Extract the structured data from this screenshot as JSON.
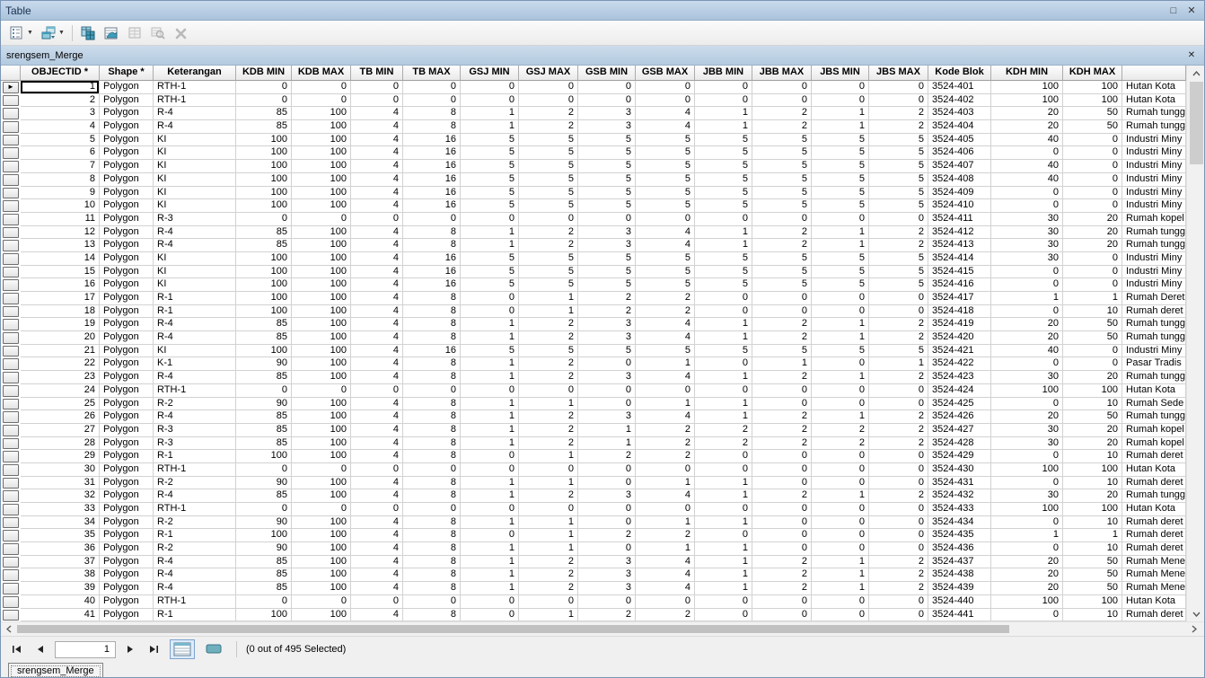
{
  "window": {
    "title": "Table",
    "maximize_icon": "□",
    "close_icon": "✕"
  },
  "toolbar": {
    "buttons": [
      {
        "name": "table-options",
        "dropdown": true,
        "enabled": true
      },
      {
        "name": "related-tables",
        "dropdown": true,
        "enabled": true
      },
      {
        "name": "select-by-attributes",
        "dropdown": false,
        "enabled": true
      },
      {
        "name": "switch-selection",
        "dropdown": false,
        "enabled": true
      },
      {
        "name": "clear-selection",
        "dropdown": false,
        "enabled": false
      },
      {
        "name": "zoom-to-selected",
        "dropdown": false,
        "enabled": false
      },
      {
        "name": "delete-selected",
        "dropdown": false,
        "enabled": false
      }
    ],
    "dropdown_caret": "▼"
  },
  "table": {
    "name": "srengsem_Merge",
    "close_icon": "✕",
    "current_record_marker": "►",
    "current_record_row": 1,
    "columns": [
      "OBJECTID *",
      "Shape *",
      "Keterangan",
      "KDB MIN",
      "KDB MAX",
      "TB MIN",
      "TB MAX",
      "GSJ MIN",
      "GSJ MAX",
      "GSB MIN",
      "GSB MAX",
      "JBB MIN",
      "JBB MAX",
      "JBS MIN",
      "JBS MAX",
      "Kode Blok",
      "KDH MIN",
      "KDH MAX",
      ""
    ],
    "rows": [
      [
        1,
        "Polygon",
        "RTH-1",
        0,
        0,
        0,
        0,
        0,
        0,
        0,
        0,
        0,
        0,
        0,
        0,
        "3524-401",
        100,
        100,
        "Hutan Kota"
      ],
      [
        2,
        "Polygon",
        "RTH-1",
        0,
        0,
        0,
        0,
        0,
        0,
        0,
        0,
        0,
        0,
        0,
        0,
        "3524-402",
        100,
        100,
        "Hutan Kota"
      ],
      [
        3,
        "Polygon",
        "R-4",
        85,
        100,
        4,
        8,
        1,
        2,
        3,
        4,
        1,
        2,
        1,
        2,
        "3524-403",
        20,
        50,
        "Rumah tungg"
      ],
      [
        4,
        "Polygon",
        "R-4",
        85,
        100,
        4,
        8,
        1,
        2,
        3,
        4,
        1,
        2,
        1,
        2,
        "3524-404",
        20,
        50,
        "Rumah tungg"
      ],
      [
        5,
        "Polygon",
        "KI",
        100,
        100,
        4,
        16,
        5,
        5,
        5,
        5,
        5,
        5,
        5,
        5,
        "3524-405",
        40,
        0,
        "Industri Miny"
      ],
      [
        6,
        "Polygon",
        "KI",
        100,
        100,
        4,
        16,
        5,
        5,
        5,
        5,
        5,
        5,
        5,
        5,
        "3524-406",
        0,
        0,
        "Industri Miny"
      ],
      [
        7,
        "Polygon",
        "KI",
        100,
        100,
        4,
        16,
        5,
        5,
        5,
        5,
        5,
        5,
        5,
        5,
        "3524-407",
        40,
        0,
        "Industri Miny"
      ],
      [
        8,
        "Polygon",
        "KI",
        100,
        100,
        4,
        16,
        5,
        5,
        5,
        5,
        5,
        5,
        5,
        5,
        "3524-408",
        40,
        0,
        "Industri Miny"
      ],
      [
        9,
        "Polygon",
        "KI",
        100,
        100,
        4,
        16,
        5,
        5,
        5,
        5,
        5,
        5,
        5,
        5,
        "3524-409",
        0,
        0,
        "Industri Miny"
      ],
      [
        10,
        "Polygon",
        "KI",
        100,
        100,
        4,
        16,
        5,
        5,
        5,
        5,
        5,
        5,
        5,
        5,
        "3524-410",
        0,
        0,
        "Industri Miny"
      ],
      [
        11,
        "Polygon",
        "R-3",
        0,
        0,
        0,
        0,
        0,
        0,
        0,
        0,
        0,
        0,
        0,
        0,
        "3524-411",
        30,
        20,
        "Rumah kopel"
      ],
      [
        12,
        "Polygon",
        "R-4",
        85,
        100,
        4,
        8,
        1,
        2,
        3,
        4,
        1,
        2,
        1,
        2,
        "3524-412",
        30,
        20,
        "Rumah tungg"
      ],
      [
        13,
        "Polygon",
        "R-4",
        85,
        100,
        4,
        8,
        1,
        2,
        3,
        4,
        1,
        2,
        1,
        2,
        "3524-413",
        30,
        20,
        "Rumah tungg"
      ],
      [
        14,
        "Polygon",
        "KI",
        100,
        100,
        4,
        16,
        5,
        5,
        5,
        5,
        5,
        5,
        5,
        5,
        "3524-414",
        30,
        0,
        "Industri Miny"
      ],
      [
        15,
        "Polygon",
        "KI",
        100,
        100,
        4,
        16,
        5,
        5,
        5,
        5,
        5,
        5,
        5,
        5,
        "3524-415",
        0,
        0,
        "Industri Miny"
      ],
      [
        16,
        "Polygon",
        "KI",
        100,
        100,
        4,
        16,
        5,
        5,
        5,
        5,
        5,
        5,
        5,
        5,
        "3524-416",
        0,
        0,
        "Industri Miny"
      ],
      [
        17,
        "Polygon",
        "R-1",
        100,
        100,
        4,
        8,
        0,
        1,
        2,
        2,
        0,
        0,
        0,
        0,
        "3524-417",
        1,
        1,
        "Rumah Deret"
      ],
      [
        18,
        "Polygon",
        "R-1",
        100,
        100,
        4,
        8,
        0,
        1,
        2,
        2,
        0,
        0,
        0,
        0,
        "3524-418",
        0,
        10,
        "Rumah deret"
      ],
      [
        19,
        "Polygon",
        "R-4",
        85,
        100,
        4,
        8,
        1,
        2,
        3,
        4,
        1,
        2,
        1,
        2,
        "3524-419",
        20,
        50,
        "Rumah tungg"
      ],
      [
        20,
        "Polygon",
        "R-4",
        85,
        100,
        4,
        8,
        1,
        2,
        3,
        4,
        1,
        2,
        1,
        2,
        "3524-420",
        20,
        50,
        "Rumah tungg"
      ],
      [
        21,
        "Polygon",
        "KI",
        100,
        100,
        4,
        16,
        5,
        5,
        5,
        5,
        5,
        5,
        5,
        5,
        "3524-421",
        40,
        0,
        "Industri Miny"
      ],
      [
        22,
        "Polygon",
        "K-1",
        90,
        100,
        4,
        8,
        1,
        2,
        0,
        1,
        0,
        1,
        0,
        1,
        "3524-422",
        0,
        0,
        "Pasar Tradis"
      ],
      [
        23,
        "Polygon",
        "R-4",
        85,
        100,
        4,
        8,
        1,
        2,
        3,
        4,
        1,
        2,
        1,
        2,
        "3524-423",
        30,
        20,
        "Rumah tungg"
      ],
      [
        24,
        "Polygon",
        "RTH-1",
        0,
        0,
        0,
        0,
        0,
        0,
        0,
        0,
        0,
        0,
        0,
        0,
        "3524-424",
        100,
        100,
        "Hutan Kota"
      ],
      [
        25,
        "Polygon",
        "R-2",
        90,
        100,
        4,
        8,
        1,
        1,
        0,
        1,
        1,
        0,
        0,
        0,
        "3524-425",
        0,
        10,
        "Rumah Sede"
      ],
      [
        26,
        "Polygon",
        "R-4",
        85,
        100,
        4,
        8,
        1,
        2,
        3,
        4,
        1,
        2,
        1,
        2,
        "3524-426",
        20,
        50,
        "Rumah tungg"
      ],
      [
        27,
        "Polygon",
        "R-3",
        85,
        100,
        4,
        8,
        1,
        2,
        1,
        2,
        2,
        2,
        2,
        2,
        "3524-427",
        30,
        20,
        "Rumah kopel"
      ],
      [
        28,
        "Polygon",
        "R-3",
        85,
        100,
        4,
        8,
        1,
        2,
        1,
        2,
        2,
        2,
        2,
        2,
        "3524-428",
        30,
        20,
        "Rumah kopel"
      ],
      [
        29,
        "Polygon",
        "R-1",
        100,
        100,
        4,
        8,
        0,
        1,
        2,
        2,
        0,
        0,
        0,
        0,
        "3524-429",
        0,
        10,
        "Rumah deret"
      ],
      [
        30,
        "Polygon",
        "RTH-1",
        0,
        0,
        0,
        0,
        0,
        0,
        0,
        0,
        0,
        0,
        0,
        0,
        "3524-430",
        100,
        100,
        "Hutan Kota"
      ],
      [
        31,
        "Polygon",
        "R-2",
        90,
        100,
        4,
        8,
        1,
        1,
        0,
        1,
        1,
        0,
        0,
        0,
        "3524-431",
        0,
        10,
        "Rumah deret"
      ],
      [
        32,
        "Polygon",
        "R-4",
        85,
        100,
        4,
        8,
        1,
        2,
        3,
        4,
        1,
        2,
        1,
        2,
        "3524-432",
        30,
        20,
        "Rumah tungg"
      ],
      [
        33,
        "Polygon",
        "RTH-1",
        0,
        0,
        0,
        0,
        0,
        0,
        0,
        0,
        0,
        0,
        0,
        0,
        "3524-433",
        100,
        100,
        "Hutan Kota"
      ],
      [
        34,
        "Polygon",
        "R-2",
        90,
        100,
        4,
        8,
        1,
        1,
        0,
        1,
        1,
        0,
        0,
        0,
        "3524-434",
        0,
        10,
        "Rumah deret"
      ],
      [
        35,
        "Polygon",
        "R-1",
        100,
        100,
        4,
        8,
        0,
        1,
        2,
        2,
        0,
        0,
        0,
        0,
        "3524-435",
        1,
        1,
        "Rumah deret"
      ],
      [
        36,
        "Polygon",
        "R-2",
        90,
        100,
        4,
        8,
        1,
        1,
        0,
        1,
        1,
        0,
        0,
        0,
        "3524-436",
        0,
        10,
        "Rumah deret"
      ],
      [
        37,
        "Polygon",
        "R-4",
        85,
        100,
        4,
        8,
        1,
        2,
        3,
        4,
        1,
        2,
        1,
        2,
        "3524-437",
        20,
        50,
        "Rumah Mene"
      ],
      [
        38,
        "Polygon",
        "R-4",
        85,
        100,
        4,
        8,
        1,
        2,
        3,
        4,
        1,
        2,
        1,
        2,
        "3524-438",
        20,
        50,
        "Rumah Mene"
      ],
      [
        39,
        "Polygon",
        "R-4",
        85,
        100,
        4,
        8,
        1,
        2,
        3,
        4,
        1,
        2,
        1,
        2,
        "3524-439",
        20,
        50,
        "Rumah Mene"
      ],
      [
        40,
        "Polygon",
        "RTH-1",
        0,
        0,
        0,
        0,
        0,
        0,
        0,
        0,
        0,
        0,
        0,
        0,
        "3524-440",
        100,
        100,
        "Hutan Kota"
      ],
      [
        41,
        "Polygon",
        "R-1",
        100,
        100,
        4,
        8,
        0,
        1,
        2,
        2,
        0,
        0,
        0,
        0,
        "3524-441",
        0,
        10,
        "Rumah deret"
      ]
    ]
  },
  "record_nav": {
    "current_record": "1",
    "status": "(0 out of 495 Selected)",
    "icons": {
      "first": "|◀",
      "previous": "◀",
      "next": "▶",
      "last": "▶|"
    },
    "view_icons": {
      "show_all_records": "table",
      "show_selected_records": "teal-bar"
    },
    "active_view": "show_all_records"
  },
  "bottom_tab": {
    "label": "srengsem_Merge"
  },
  "colors": {
    "titlebar_top": "#CADAEC",
    "titlebar_bottom": "#A9C3DC",
    "icon_teal": "#3D9DBC",
    "selection_border": "#7DA2CE",
    "grid_line": "#D2D2D2",
    "header_border": "#ACACAC"
  }
}
